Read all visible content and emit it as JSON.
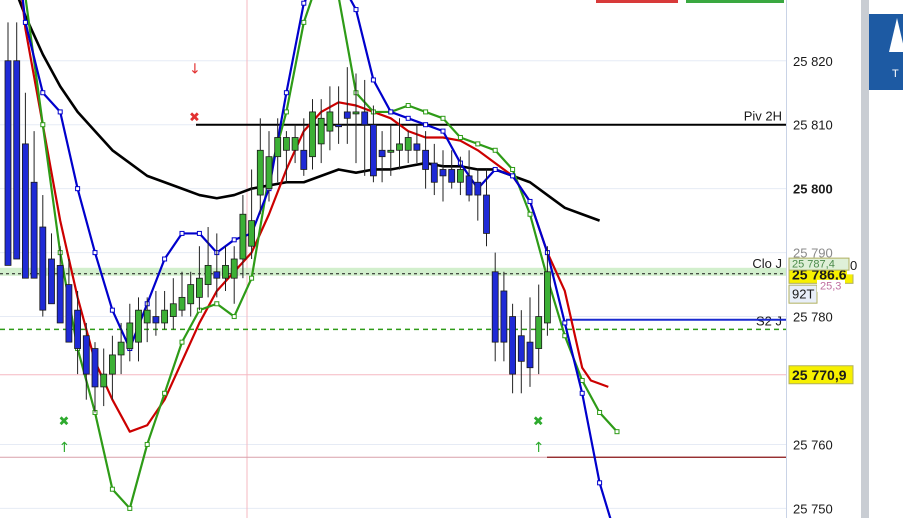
{
  "chart_data": {
    "type": "candlestick",
    "title": "",
    "xlabel": "",
    "ylabel": "",
    "ylim": [
      25748.5,
      25829.5
    ],
    "grid": true,
    "y_ticks": [
      25820,
      25810,
      25800,
      25780,
      25760,
      25750
    ],
    "y_tick_labels": [
      "25 820",
      "25 810",
      "25 800",
      "25 780",
      "25 760",
      "25 750"
    ],
    "hidden_tick_label": "25 790",
    "candles": [
      {
        "o": 25820,
        "h": 25826,
        "l": 25788,
        "c": 25788,
        "color": "blue"
      },
      {
        "o": 25820,
        "h": 25826,
        "l": 25789,
        "c": 25789,
        "color": "blue"
      },
      {
        "o": 25807,
        "h": 25815,
        "l": 25786,
        "c": 25786,
        "color": "blue"
      },
      {
        "o": 25801,
        "h": 25809,
        "l": 25786,
        "c": 25786,
        "color": "blue"
      },
      {
        "o": 25794,
        "h": 25799,
        "l": 25780,
        "c": 25781,
        "color": "blue"
      },
      {
        "o": 25789,
        "h": 25793,
        "l": 25782,
        "c": 25782,
        "color": "blue"
      },
      {
        "o": 25788,
        "h": 25791,
        "l": 25779,
        "c": 25779,
        "color": "blue"
      },
      {
        "o": 25785,
        "h": 25789,
        "l": 25776,
        "c": 25776,
        "color": "blue"
      },
      {
        "o": 25781,
        "h": 25784,
        "l": 25771,
        "c": 25775,
        "color": "blue"
      },
      {
        "o": 25777,
        "h": 25779,
        "l": 25767,
        "c": 25771,
        "color": "blue"
      },
      {
        "o": 25775,
        "h": 25776,
        "l": 25765,
        "c": 25769,
        "color": "blue"
      },
      {
        "o": 25769,
        "h": 25775,
        "l": 25766,
        "c": 25771,
        "color": "green"
      },
      {
        "o": 25771,
        "h": 25777,
        "l": 25767,
        "c": 25774,
        "color": "green"
      },
      {
        "o": 25774,
        "h": 25779,
        "l": 25771,
        "c": 25776,
        "color": "green"
      },
      {
        "o": 25775,
        "h": 25782,
        "l": 25773,
        "c": 25779,
        "color": "green"
      },
      {
        "o": 25776,
        "h": 25783,
        "l": 25773,
        "c": 25781,
        "color": "green"
      },
      {
        "o": 25779,
        "h": 25783,
        "l": 25776,
        "c": 25781,
        "color": "green"
      },
      {
        "o": 25779,
        "h": 25784,
        "l": 25777,
        "c": 25780,
        "color": "blue"
      },
      {
        "o": 25779,
        "h": 25784,
        "l": 25778,
        "c": 25781,
        "color": "green"
      },
      {
        "o": 25780,
        "h": 25786,
        "l": 25778,
        "c": 25782,
        "color": "green"
      },
      {
        "o": 25781,
        "h": 25787,
        "l": 25780,
        "c": 25783,
        "color": "green"
      },
      {
        "o": 25782,
        "h": 25787,
        "l": 25780,
        "c": 25785,
        "color": "green"
      },
      {
        "o": 25783,
        "h": 25791,
        "l": 25781,
        "c": 25786,
        "color": "green"
      },
      {
        "o": 25785,
        "h": 25794,
        "l": 25783,
        "c": 25788,
        "color": "green"
      },
      {
        "o": 25786,
        "h": 25793,
        "l": 25783,
        "c": 25787,
        "color": "blue"
      },
      {
        "o": 25786,
        "h": 25791,
        "l": 25784,
        "c": 25788,
        "color": "green"
      },
      {
        "o": 25786,
        "h": 25791,
        "l": 25782,
        "c": 25789,
        "color": "green"
      },
      {
        "o": 25789,
        "h": 25799,
        "l": 25786,
        "c": 25796,
        "color": "green"
      },
      {
        "o": 25791,
        "h": 25803,
        "l": 25789,
        "c": 25795,
        "color": "green"
      },
      {
        "o": 25799,
        "h": 25811,
        "l": 25796,
        "c": 25806,
        "color": "green"
      },
      {
        "o": 25800,
        "h": 25809,
        "l": 25798,
        "c": 25805,
        "color": "green"
      },
      {
        "o": 25805,
        "h": 25811,
        "l": 25801,
        "c": 25808,
        "color": "green"
      },
      {
        "o": 25806,
        "h": 25809,
        "l": 25801,
        "c": 25808,
        "color": "green"
      },
      {
        "o": 25806,
        "h": 25810,
        "l": 25804,
        "c": 25808,
        "color": "green"
      },
      {
        "o": 25806,
        "h": 25811,
        "l": 25802,
        "c": 25803,
        "color": "blue"
      },
      {
        "o": 25805,
        "h": 25814,
        "l": 25803,
        "c": 25812,
        "color": "green"
      },
      {
        "o": 25807,
        "h": 25814,
        "l": 25804,
        "c": 25811,
        "color": "green"
      },
      {
        "o": 25809,
        "h": 25816,
        "l": 25806,
        "c": 25812,
        "color": "green"
      },
      {
        "o": 25810,
        "h": 25816,
        "l": 25807,
        "c": 25810,
        "color": "blue"
      },
      {
        "o": 25812,
        "h": 25819,
        "l": 25807,
        "c": 25811,
        "color": "blue"
      },
      {
        "o": 25812,
        "h": 25818,
        "l": 25804,
        "c": 25812,
        "color": "green"
      },
      {
        "o": 25812,
        "h": 25817,
        "l": 25802,
        "c": 25810,
        "color": "blue"
      },
      {
        "o": 25810,
        "h": 25813,
        "l": 25801,
        "c": 25802,
        "color": "blue"
      },
      {
        "o": 25806,
        "h": 25809,
        "l": 25801,
        "c": 25805,
        "color": "blue"
      },
      {
        "o": 25806,
        "h": 25810,
        "l": 25802,
        "c": 25806,
        "color": "green"
      },
      {
        "o": 25806,
        "h": 25811,
        "l": 25803,
        "c": 25807,
        "color": "green"
      },
      {
        "o": 25806,
        "h": 25809,
        "l": 25804,
        "c": 25808,
        "color": "green"
      },
      {
        "o": 25807,
        "h": 25810,
        "l": 25804,
        "c": 25806,
        "color": "blue"
      },
      {
        "o": 25806,
        "h": 25809,
        "l": 25800,
        "c": 25803,
        "color": "blue"
      },
      {
        "o": 25804,
        "h": 25807,
        "l": 25799,
        "c": 25801,
        "color": "blue"
      },
      {
        "o": 25803,
        "h": 25806,
        "l": 25798,
        "c": 25802,
        "color": "blue"
      },
      {
        "o": 25803,
        "h": 25806,
        "l": 25800,
        "c": 25801,
        "color": "blue"
      },
      {
        "o": 25803,
        "h": 25805,
        "l": 25799,
        "c": 25801,
        "color": "green"
      },
      {
        "o": 25802,
        "h": 25806,
        "l": 25798,
        "c": 25799,
        "color": "blue"
      },
      {
        "o": 25801,
        "h": 25803,
        "l": 25795,
        "c": 25799,
        "color": "blue"
      },
      {
        "o": 25799,
        "h": 25803,
        "l": 25791,
        "c": 25793,
        "color": "blue"
      },
      {
        "o": 25787,
        "h": 25790,
        "l": 25773,
        "c": 25776,
        "color": "blue"
      },
      {
        "o": 25784,
        "h": 25787,
        "l": 25773,
        "c": 25776,
        "color": "blue"
      },
      {
        "o": 25780,
        "h": 25782,
        "l": 25768,
        "c": 25771,
        "color": "blue"
      },
      {
        "o": 25777,
        "h": 25781,
        "l": 25768,
        "c": 25773,
        "color": "blue"
      },
      {
        "o": 25776,
        "h": 25783,
        "l": 25769,
        "c": 25772,
        "color": "blue"
      },
      {
        "o": 25775,
        "h": 25785,
        "l": 25771,
        "c": 25780,
        "color": "green"
      },
      {
        "o": 25779,
        "h": 25791,
        "l": 25777,
        "c": 25787,
        "color": "green"
      }
    ],
    "overlays": [
      {
        "kind": "line",
        "color": "#000000",
        "points": [
          [
            0,
            25834
          ],
          [
            4,
            25827
          ],
          [
            8,
            25821
          ],
          [
            12,
            25816
          ],
          [
            16,
            25812
          ],
          [
            20,
            25809
          ],
          [
            24,
            25806
          ],
          [
            28,
            25804
          ],
          [
            32,
            25802
          ],
          [
            36,
            25801
          ],
          [
            40,
            25800
          ],
          [
            44,
            25799
          ],
          [
            48,
            25798.5
          ],
          [
            52,
            25799
          ],
          [
            56,
            25800
          ],
          [
            60,
            25800.5
          ],
          [
            64,
            25801
          ],
          [
            68,
            25801
          ],
          [
            72,
            25802
          ],
          [
            76,
            25803
          ],
          [
            80,
            25802.5
          ],
          [
            84,
            25803
          ],
          [
            88,
            25803
          ],
          [
            92,
            25803.5
          ],
          [
            96,
            25804
          ],
          [
            100,
            25803.5
          ],
          [
            104,
            25803.5
          ],
          [
            108,
            25803
          ],
          [
            112,
            25803
          ],
          [
            116,
            25802
          ],
          [
            120,
            25801
          ],
          [
            124,
            25799
          ],
          [
            128,
            25797
          ],
          [
            132,
            25796
          ],
          [
            136,
            25795
          ]
        ]
      },
      {
        "kind": "line",
        "color": "#cc0000",
        "points": [
          [
            0,
            25850
          ],
          [
            4,
            25825
          ],
          [
            8,
            25810
          ],
          [
            12,
            25795
          ],
          [
            16,
            25783
          ],
          [
            20,
            25773
          ],
          [
            24,
            25767
          ],
          [
            28,
            25762
          ],
          [
            32,
            25763
          ],
          [
            36,
            25767
          ],
          [
            40,
            25773
          ],
          [
            44,
            25779
          ],
          [
            48,
            25784
          ],
          [
            52,
            25787
          ],
          [
            56,
            25790
          ],
          [
            60,
            25796
          ],
          [
            64,
            25803
          ],
          [
            68,
            25809
          ],
          [
            72,
            25812
          ],
          [
            76,
            25813.5
          ],
          [
            80,
            25813
          ],
          [
            84,
            25812
          ],
          [
            88,
            25811
          ],
          [
            92,
            25809
          ],
          [
            96,
            25808
          ],
          [
            100,
            25808
          ],
          [
            104,
            25807.5
          ],
          [
            108,
            25806
          ],
          [
            112,
            25804
          ],
          [
            116,
            25802
          ],
          [
            120,
            25798
          ],
          [
            124,
            25790
          ],
          [
            128,
            25784
          ],
          [
            130,
            25778
          ],
          [
            132,
            25772
          ],
          [
            134,
            25770
          ],
          [
            138,
            25769
          ]
        ]
      },
      {
        "kind": "line",
        "color": "#2e9b17",
        "points": [
          [
            0,
            25850
          ],
          [
            8,
            25810
          ],
          [
            12,
            25790
          ],
          [
            16,
            25775
          ],
          [
            20,
            25765
          ],
          [
            24,
            25753
          ],
          [
            28,
            25750
          ],
          [
            32,
            25760
          ],
          [
            36,
            25768
          ],
          [
            40,
            25776
          ],
          [
            44,
            25781
          ],
          [
            48,
            25782
          ],
          [
            52,
            25780
          ],
          [
            56,
            25786
          ],
          [
            60,
            25802
          ],
          [
            64,
            25812
          ],
          [
            68,
            25826
          ],
          [
            72,
            25834
          ],
          [
            76,
            25830
          ],
          [
            80,
            25815
          ],
          [
            84,
            25812
          ],
          [
            88,
            25812
          ],
          [
            92,
            25813
          ],
          [
            96,
            25812
          ],
          [
            100,
            25811
          ],
          [
            104,
            25808
          ],
          [
            108,
            25807
          ],
          [
            112,
            25806
          ],
          [
            116,
            25803
          ],
          [
            120,
            25796
          ],
          [
            124,
            25786
          ],
          [
            128,
            25777
          ],
          [
            132,
            25770
          ],
          [
            136,
            25765
          ],
          [
            140,
            25762
          ]
        ]
      },
      {
        "kind": "line",
        "color": "#0000cc",
        "points": [
          [
            0,
            25850
          ],
          [
            4,
            25826
          ],
          [
            8,
            25815
          ],
          [
            12,
            25812
          ],
          [
            16,
            25800
          ],
          [
            20,
            25790
          ],
          [
            24,
            25781
          ],
          [
            28,
            25775
          ],
          [
            32,
            25782
          ],
          [
            36,
            25789
          ],
          [
            40,
            25793
          ],
          [
            44,
            25793
          ],
          [
            48,
            25790
          ],
          [
            52,
            25792
          ],
          [
            56,
            25793
          ],
          [
            60,
            25800
          ],
          [
            64,
            25815
          ],
          [
            68,
            25829
          ],
          [
            72,
            25834
          ],
          [
            76,
            25833
          ],
          [
            80,
            25828
          ],
          [
            84,
            25817
          ],
          [
            88,
            25812
          ],
          [
            92,
            25811
          ],
          [
            96,
            25810
          ],
          [
            100,
            25809
          ],
          [
            104,
            25804
          ],
          [
            108,
            25800
          ],
          [
            112,
            25803
          ],
          [
            116,
            25802
          ],
          [
            120,
            25798
          ],
          [
            124,
            25790
          ],
          [
            128,
            25779
          ],
          [
            132,
            25768
          ],
          [
            136,
            25754
          ],
          [
            140,
            25745
          ]
        ]
      }
    ],
    "horizontal_lines": [
      {
        "label": "Piv 2H",
        "value": 25810,
        "color": "#000000"
      },
      {
        "label": "Clo J",
        "value": 25787,
        "color": "#2e9b17"
      },
      {
        "label": "S2 J",
        "value": 25778,
        "color": "#2e9b17"
      }
    ],
    "badges": [
      {
        "label": "25 786,6",
        "value": 25786.6,
        "bg": "#f7f000"
      },
      {
        "label": "25 770,9",
        "value": 25770.9,
        "bg": "#f7f000"
      },
      {
        "label": "92T",
        "value": 25783.5,
        "bg": "#e8eef8"
      },
      {
        "label": "0",
        "value": 25788,
        "bg": "#ffffff"
      },
      {
        "label": "25 787,4",
        "value": 25788.2,
        "bg": "#dff0d8"
      },
      {
        "label": "25,3",
        "value": 25784.8,
        "bg": "#ffffff"
      }
    ],
    "signals": [
      {
        "kind": "sell",
        "x": 43
      },
      {
        "kind": "buy",
        "x": 13
      },
      {
        "kind": "buy",
        "x": 122
      }
    ]
  },
  "colors": {
    "up": "#3cb035",
    "down": "#1f2ad6",
    "grid": "#e6ebf5",
    "crosshair": "#f5b8c2"
  },
  "icons": [
    "sell-arrow-icon",
    "buy-arrow-icon",
    "cross-icon"
  ]
}
